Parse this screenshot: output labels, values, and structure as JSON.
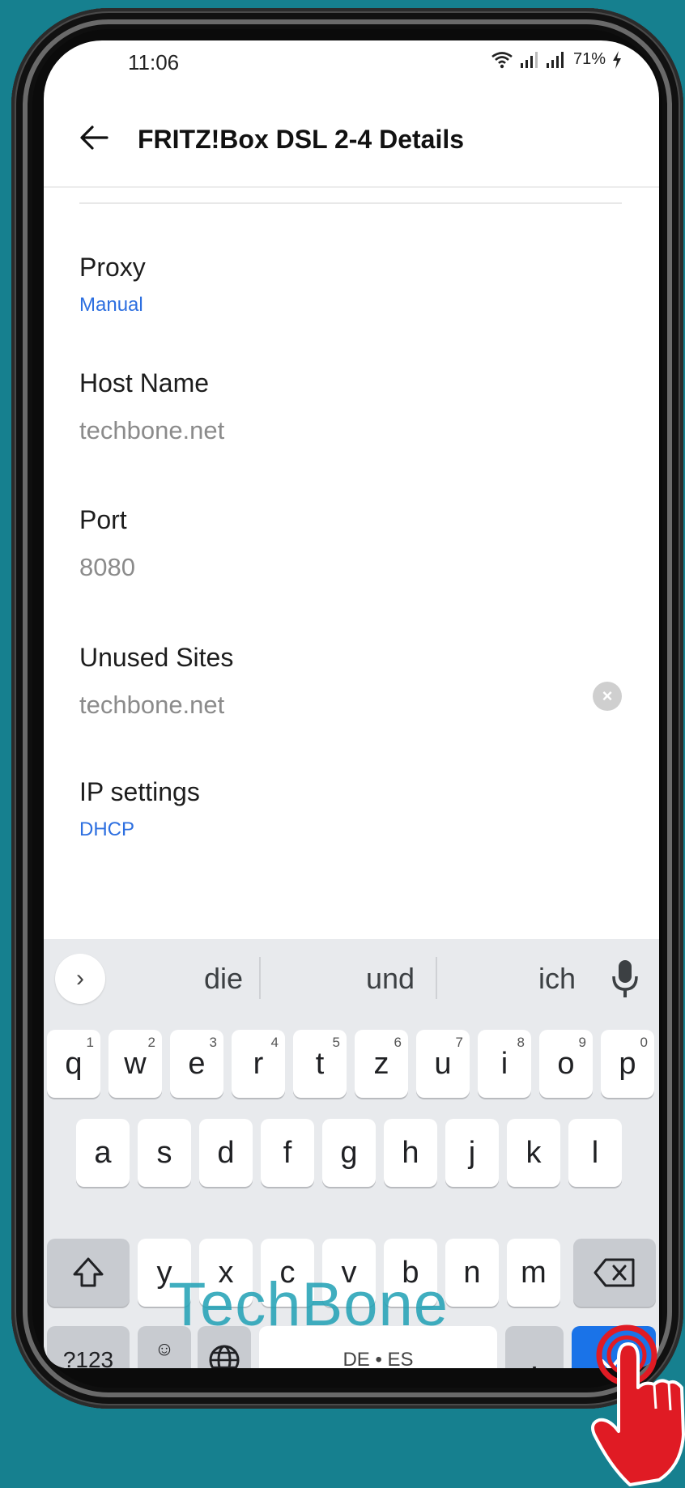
{
  "status_bar": {
    "time": "11:06",
    "battery": "71%"
  },
  "app_bar": {
    "title": "FRITZ!Box DSL 2-4 Details"
  },
  "settings": {
    "proxy": {
      "label": "Proxy",
      "value": "Manual"
    },
    "host_name": {
      "label": "Host Name",
      "value": "techbone.net"
    },
    "port": {
      "label": "Port",
      "value": "8080"
    },
    "unused_sites": {
      "label": "Unused Sites",
      "value": "techbone.net"
    },
    "ip_settings": {
      "label": "IP settings",
      "value": "DHCP"
    }
  },
  "keyboard": {
    "suggestions": [
      "die",
      "und",
      "ich"
    ],
    "row1": [
      {
        "k": "q",
        "h": "1"
      },
      {
        "k": "w",
        "h": "2"
      },
      {
        "k": "e",
        "h": "3"
      },
      {
        "k": "r",
        "h": "4"
      },
      {
        "k": "t",
        "h": "5"
      },
      {
        "k": "z",
        "h": "6"
      },
      {
        "k": "u",
        "h": "7"
      },
      {
        "k": "i",
        "h": "8"
      },
      {
        "k": "o",
        "h": "9"
      },
      {
        "k": "p",
        "h": "0"
      }
    ],
    "row2": [
      "a",
      "s",
      "d",
      "f",
      "g",
      "h",
      "j",
      "k",
      "l"
    ],
    "row3": [
      "y",
      "x",
      "c",
      "v",
      "b",
      "n",
      "m"
    ],
    "symbols_key": "?123",
    "emoji_key_top": "☺",
    "emoji_key_bottom": ",",
    "space_label": "DE • ES",
    "period_key": "."
  },
  "watermark": "TechBone",
  "colors": {
    "accent_blue": "#2d6fe0",
    "background": "#16808f",
    "enter_key": "#1a73e8"
  }
}
